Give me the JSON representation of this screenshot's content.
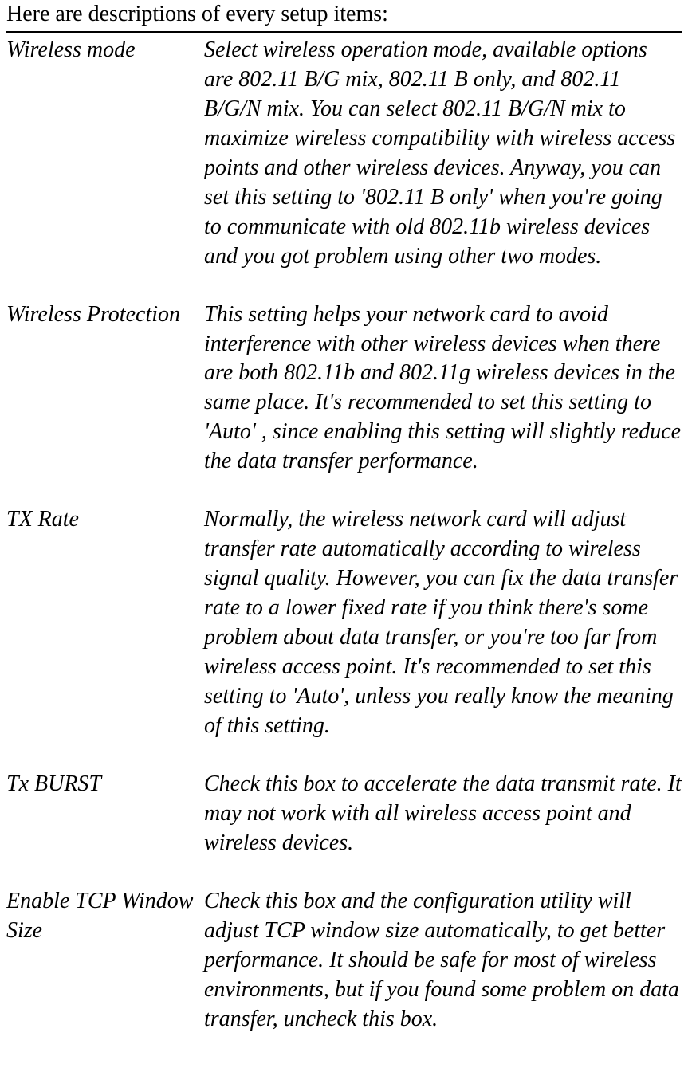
{
  "intro": "Here are descriptions of every setup items:",
  "items": [
    {
      "term": "Wireless mode",
      "desc": "Select wireless operation mode, available options are 802.11 B/G mix, 802.11 B only, and 802.11 B/G/N mix. You can select 802.11 B/G/N mix to maximize wireless compatibility with wireless access points and other wireless devices. Anyway, you can set this setting to '802.11 B only' when you're going to communicate with old 802.11b wireless devices and you got problem using other two modes."
    },
    {
      "term": "Wireless Protection",
      "desc": "This setting helps your network card to avoid interference with other wireless devices when there are both 802.11b and 802.11g wireless devices in the same place. It's recommended to set this setting to 'Auto' , since enabling this setting will slightly reduce the data transfer performance."
    },
    {
      "term": "TX Rate",
      "desc": "Normally, the wireless network card will adjust transfer rate automatically according to wireless signal quality. However, you can fix the data transfer rate to a lower fixed rate if you think there's some problem about data transfer, or you're too far from wireless access point. It's recommended to set this setting to 'Auto', unless you really know the meaning of this setting."
    },
    {
      "term": "Tx BURST",
      "desc": "Check this box to accelerate the data transmit rate. It may not work with all wireless access point and wireless devices."
    },
    {
      "term": "Enable TCP Window Size",
      "desc": "Check this box and the configuration utility will adjust TCP window size automatically, to get better performance. It should be safe for most of wireless environments, but if you found some problem on data transfer, uncheck this box."
    }
  ]
}
